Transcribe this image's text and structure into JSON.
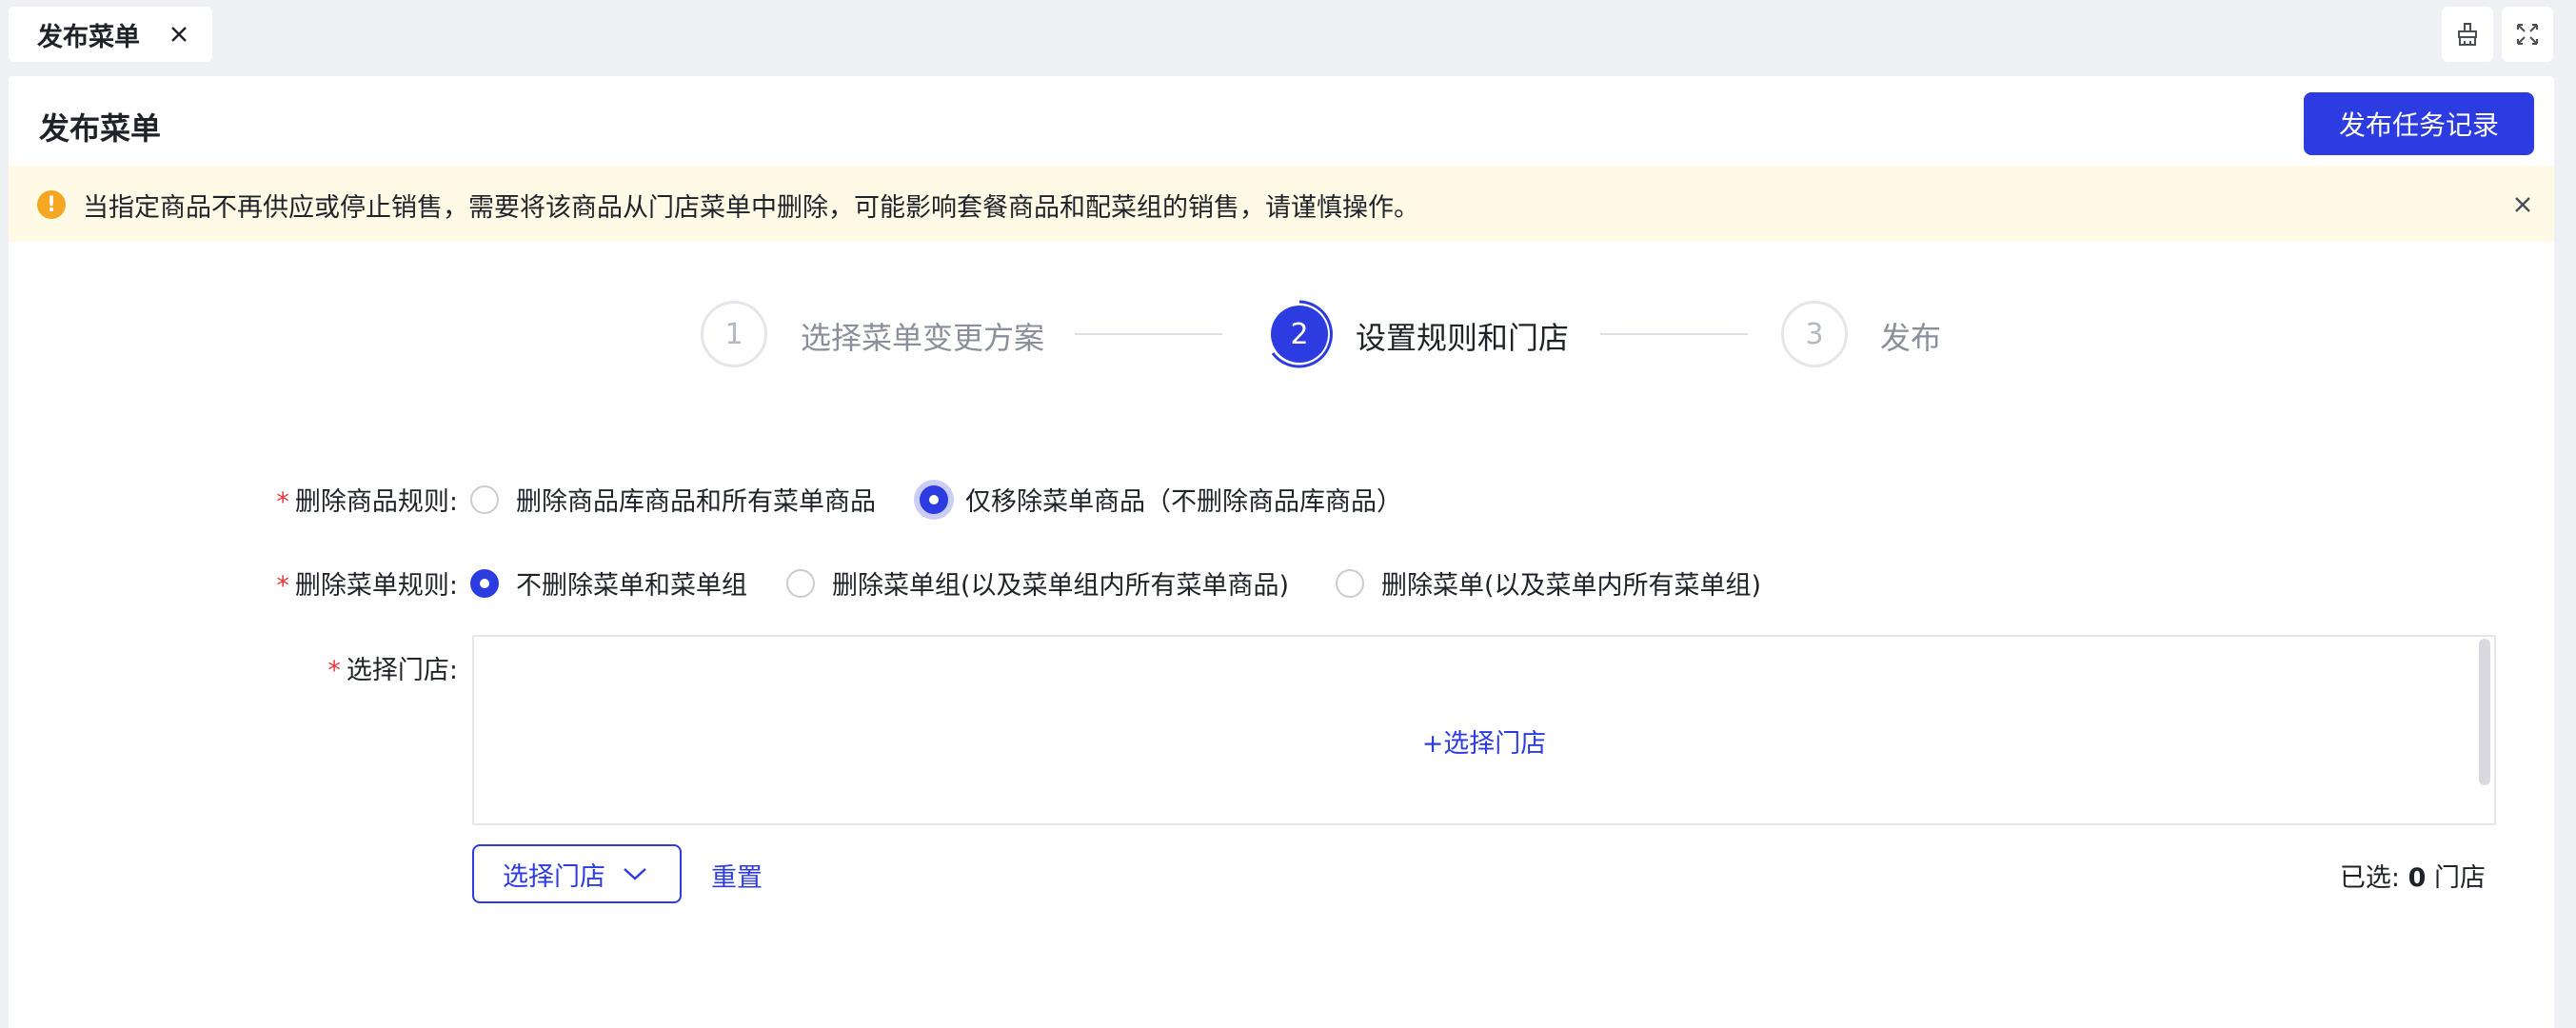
{
  "tab": {
    "label": "发布菜单"
  },
  "header": {
    "title": "发布菜单",
    "publish_records_label": "发布任务记录"
  },
  "alert": {
    "icon_text": "!",
    "message": "当指定商品不再供应或停止销售，需要将该商品从门店菜单中删除，可能影响套餐商品和配菜组的销售，请谨慎操作。"
  },
  "steps": [
    {
      "number": "1",
      "label": "选择菜单变更方案"
    },
    {
      "number": "2",
      "label": "设置规则和门店"
    },
    {
      "number": "3",
      "label": "发布"
    }
  ],
  "form": {
    "required_mark": "*",
    "delete_product_rule": {
      "label": "删除商品规则:",
      "options": [
        "删除商品库商品和所有菜单商品",
        "仅移除菜单商品（不删除商品库商品）"
      ],
      "selected_index": 1
    },
    "delete_menu_rule": {
      "label": "删除菜单规则:",
      "options": [
        "不删除菜单和菜单组",
        "删除菜单组(以及菜单组内所有菜单商品)",
        "删除菜单(以及菜单内所有菜单组)"
      ],
      "selected_index": 0
    },
    "select_store": {
      "label": "选择门店:",
      "add_label": "+选择门店",
      "dropdown_label": "选择门店",
      "reset_label": "重置",
      "selected_prefix": "已选: ",
      "selected_count": "0",
      "selected_suffix": " 门店"
    }
  },
  "colors": {
    "primary": "#2d3ce0",
    "warning": "#f5a623",
    "alert_bg": "#fffae6",
    "required": "#e8373a"
  }
}
